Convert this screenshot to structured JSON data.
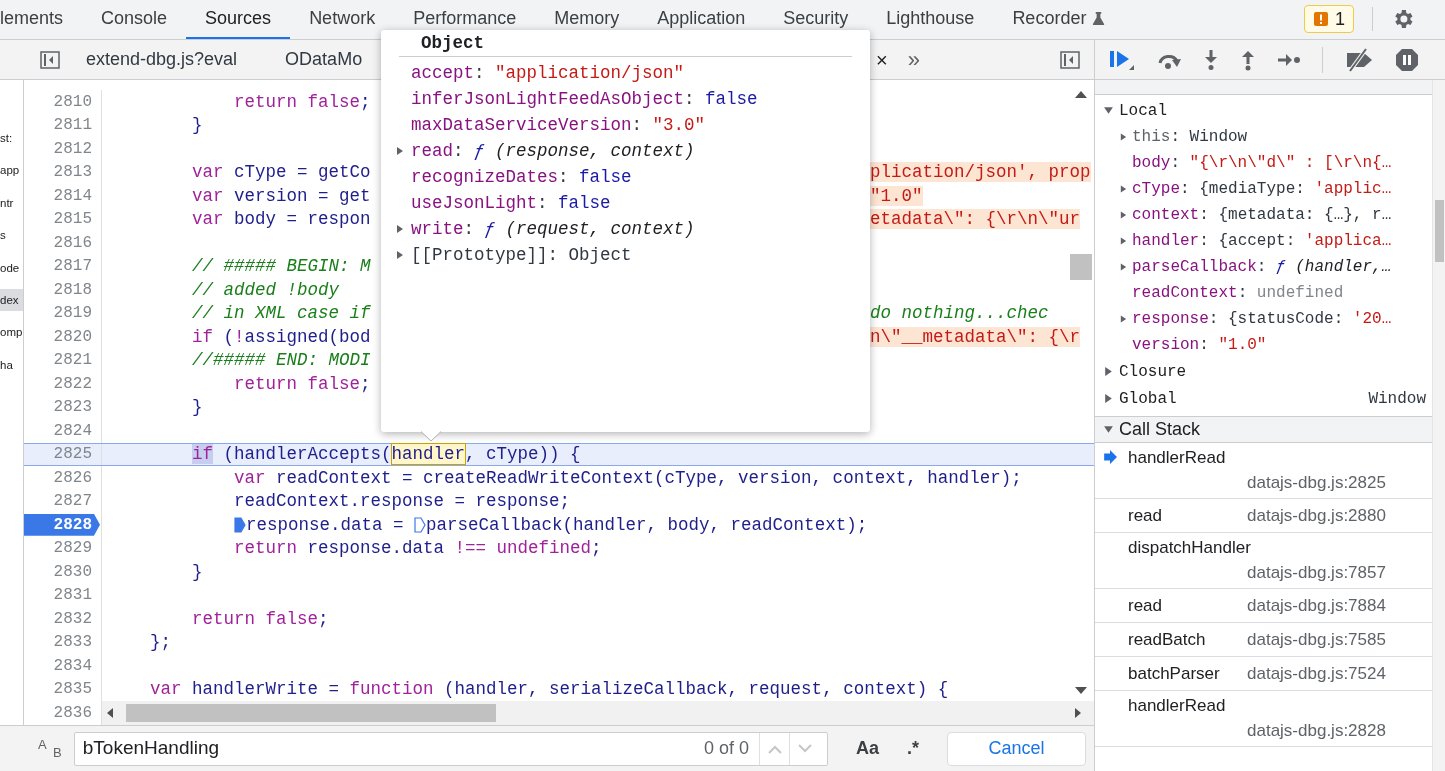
{
  "tabs": [
    {
      "label": "lements",
      "selected": false,
      "experimental": false
    },
    {
      "label": "Console",
      "selected": false,
      "experimental": false
    },
    {
      "label": "Sources",
      "selected": true,
      "experimental": false
    },
    {
      "label": "Network",
      "selected": false,
      "experimental": false
    },
    {
      "label": "Performance",
      "selected": false,
      "experimental": false
    },
    {
      "label": "Memory",
      "selected": false,
      "experimental": false
    },
    {
      "label": "Application",
      "selected": false,
      "experimental": false
    },
    {
      "label": "Security",
      "selected": false,
      "experimental": false
    },
    {
      "label": "Lighthouse",
      "selected": false,
      "experimental": false
    },
    {
      "label": "Recorder",
      "selected": false,
      "experimental": true
    }
  ],
  "issues": {
    "count": "1"
  },
  "file_tabs": [
    {
      "label": "extend-dbg.js?eval"
    },
    {
      "label": "ODataMo"
    }
  ],
  "file_tabs_close": "×",
  "file_tabs_more": "»",
  "navigator": [
    {
      "text": "st:",
      "selected": false
    },
    {
      "text": "app",
      "selected": false
    },
    {
      "text": "ntr",
      "selected": false
    },
    {
      "text": "s",
      "selected": false
    },
    {
      "text": "ode",
      "selected": false
    },
    {
      "text": "dex",
      "selected": true
    },
    {
      "text": "omp",
      "selected": false
    },
    {
      "text": "ha",
      "selected": false
    }
  ],
  "code_lines": [
    {
      "n": "2810",
      "highlighted": false,
      "breakpoint": false,
      "segs": [
        {
          "kind": "kw",
          "text": "            return false"
        },
        {
          "kind": "id",
          "text": ";"
        }
      ]
    },
    {
      "n": "2811",
      "highlighted": false,
      "breakpoint": false,
      "segs": [
        {
          "kind": "id",
          "text": "        }"
        }
      ]
    },
    {
      "n": "2812",
      "highlighted": false,
      "breakpoint": false
    },
    {
      "n": "2813",
      "highlighted": false,
      "breakpoint": false,
      "segs": [
        {
          "kind": "kw",
          "text": "        var"
        },
        {
          "kind": "id",
          "text": " cType = getCo"
        }
      ],
      "right": [
        {
          "kind": "inline",
          "text": "plication/json', prop"
        }
      ]
    },
    {
      "n": "2814",
      "highlighted": false,
      "breakpoint": false,
      "segs": [
        {
          "kind": "kw",
          "text": "        var"
        },
        {
          "kind": "id",
          "text": " version = get"
        }
      ],
      "right": [
        {
          "kind": "inline",
          "text": "\"1.0\""
        }
      ]
    },
    {
      "n": "2815",
      "highlighted": false,
      "breakpoint": false,
      "segs": [
        {
          "kind": "kw",
          "text": "        var"
        },
        {
          "kind": "id",
          "text": " body = respon"
        }
      ],
      "right": [
        {
          "kind": "inline",
          "text": "etadata\\\": {\\r\\n\\\"ur"
        }
      ]
    },
    {
      "n": "2816",
      "highlighted": false,
      "breakpoint": false
    },
    {
      "n": "2817",
      "highlighted": false,
      "breakpoint": false,
      "segs": [
        {
          "kind": "comment",
          "text": "        // ##### BEGIN: M"
        }
      ]
    },
    {
      "n": "2818",
      "highlighted": false,
      "breakpoint": false,
      "segs": [
        {
          "kind": "comment",
          "text": "        // added !body"
        }
      ]
    },
    {
      "n": "2819",
      "highlighted": false,
      "breakpoint": false,
      "segs": [
        {
          "kind": "comment",
          "text": "        // in XML case if"
        }
      ],
      "right": [
        {
          "kind": "comment",
          "text": "do nothing...chec"
        }
      ]
    },
    {
      "n": "2820",
      "highlighted": false,
      "breakpoint": false,
      "segs": [
        {
          "kind": "kw",
          "text": "        if"
        },
        {
          "kind": "id",
          "text": " ("
        },
        {
          "kind": "kw",
          "text": "!"
        },
        {
          "kind": "id",
          "text": "assigned(bod"
        }
      ],
      "right": [
        {
          "kind": "inline",
          "text": "n\\\"__metadata\\\": {\\r"
        }
      ]
    },
    {
      "n": "2821",
      "highlighted": false,
      "breakpoint": false,
      "segs": [
        {
          "kind": "comment",
          "text": "        //##### END: MODI"
        }
      ]
    },
    {
      "n": "2822",
      "highlighted": false,
      "breakpoint": false,
      "segs": [
        {
          "kind": "kw",
          "text": "            return false"
        },
        {
          "kind": "id",
          "text": ";"
        }
      ]
    },
    {
      "n": "2823",
      "highlighted": false,
      "breakpoint": false,
      "segs": [
        {
          "kind": "id",
          "text": "        }"
        }
      ]
    },
    {
      "n": "2824",
      "highlighted": false,
      "breakpoint": false
    },
    {
      "n": "2825",
      "highlighted": true,
      "breakpoint": false,
      "segs": [
        {
          "kind": "kwsel",
          "text": "        if"
        },
        {
          "kind": "id",
          "text": " (handlerAccepts("
        },
        {
          "kind": "hover",
          "text": "handler"
        },
        {
          "kind": "id",
          "text": ", cType)) {"
        }
      ]
    },
    {
      "n": "2826",
      "highlighted": false,
      "breakpoint": false,
      "segs": [
        {
          "kind": "kw",
          "text": "            var"
        },
        {
          "kind": "id",
          "text": " readContext = createReadWriteContext(cType, version, context, handler);"
        }
      ]
    },
    {
      "n": "2827",
      "highlighted": false,
      "breakpoint": false,
      "segs": [
        {
          "kind": "id",
          "text": "            readContext.response = response;"
        }
      ]
    },
    {
      "n": "2828",
      "highlighted": false,
      "breakpoint": true,
      "segs": [
        {
          "kind": "id",
          "text": "            response.data = ",
          "marker_filled": true
        },
        {
          "kind": "id",
          "text": "parseCallback(handler, body, readContext);",
          "marker_filled": false
        }
      ]
    },
    {
      "n": "2829",
      "highlighted": false,
      "breakpoint": false,
      "segs": [
        {
          "kind": "kw",
          "text": "            return"
        },
        {
          "kind": "id",
          "text": " response.data "
        },
        {
          "kind": "kw",
          "text": "!== undefined"
        },
        {
          "kind": "id",
          "text": ";"
        }
      ]
    },
    {
      "n": "2830",
      "highlighted": false,
      "breakpoint": false,
      "segs": [
        {
          "kind": "id",
          "text": "        }"
        }
      ]
    },
    {
      "n": "2831",
      "highlighted": false,
      "breakpoint": false
    },
    {
      "n": "2832",
      "highlighted": false,
      "breakpoint": false,
      "segs": [
        {
          "kind": "kw",
          "text": "        return false"
        },
        {
          "kind": "id",
          "text": ";"
        }
      ]
    },
    {
      "n": "2833",
      "highlighted": false,
      "breakpoint": false,
      "segs": [
        {
          "kind": "id",
          "text": "    };"
        }
      ]
    },
    {
      "n": "2834",
      "highlighted": false,
      "breakpoint": false
    },
    {
      "n": "2835",
      "highlighted": false,
      "breakpoint": false,
      "segs": [
        {
          "kind": "kw",
          "text": "    var"
        },
        {
          "kind": "id",
          "text": " handlerWrite = "
        },
        {
          "kind": "kw",
          "text": "function"
        },
        {
          "kind": "id",
          "text": " (handler, serializeCallback, request, context) {"
        }
      ]
    },
    {
      "n": "2836",
      "highlighted": false,
      "breakpoint": false
    }
  ],
  "popover": {
    "title": "Object",
    "props": [
      {
        "name": "accept",
        "dim": false,
        "expandable": false,
        "value": [
          {
            "kind": "sep",
            "text": ": "
          },
          {
            "kind": "str",
            "text": "\"application/json\""
          }
        ]
      },
      {
        "name": "inferJsonLightFeedAsObject",
        "dim": false,
        "expandable": false,
        "value": [
          {
            "kind": "sep",
            "text": ": "
          },
          {
            "kind": "bool",
            "text": "false"
          }
        ]
      },
      {
        "name": "maxDataServiceVersion",
        "dim": false,
        "expandable": false,
        "value": [
          {
            "kind": "sep",
            "text": ": "
          },
          {
            "kind": "str",
            "text": "\"3.0\""
          }
        ]
      },
      {
        "name": "read",
        "dim": false,
        "expandable": true,
        "value": [
          {
            "kind": "sep",
            "text": ": "
          },
          {
            "kind": "fn",
            "text": "ƒ"
          },
          {
            "kind": "italic",
            "text": " (response, context)"
          }
        ]
      },
      {
        "name": "recognizeDates",
        "dim": false,
        "expandable": false,
        "value": [
          {
            "kind": "sep",
            "text": ": "
          },
          {
            "kind": "bool",
            "text": "false"
          }
        ]
      },
      {
        "name": "useJsonLight",
        "dim": false,
        "expandable": false,
        "value": [
          {
            "kind": "sep",
            "text": ": "
          },
          {
            "kind": "bool",
            "text": "false"
          }
        ]
      },
      {
        "name": "write",
        "dim": false,
        "expandable": true,
        "value": [
          {
            "kind": "sep",
            "text": ": "
          },
          {
            "kind": "fn",
            "text": "ƒ"
          },
          {
            "kind": "italic",
            "text": " (request, context)"
          }
        ]
      },
      {
        "name": "[[Prototype]]",
        "dim": true,
        "expandable": true,
        "value": [
          {
            "kind": "sep",
            "text": ": "
          },
          {
            "kind": "plain",
            "text": "Object"
          }
        ]
      }
    ]
  },
  "scope": [
    {
      "name": "Local",
      "expanded": true,
      "children": [
        {
          "name": "this",
          "dim": true,
          "expandable": true,
          "value": [
            {
              "kind": "sep",
              "text": ": "
            },
            {
              "kind": "plain",
              "text": "Window"
            }
          ]
        },
        {
          "name": "body",
          "dim": false,
          "expandable": false,
          "value": [
            {
              "kind": "sep",
              "text": ": "
            },
            {
              "kind": "str",
              "text": "\"{\\r\\n\\\"d\\\" : [\\r\\n{…"
            }
          ]
        },
        {
          "name": "cType",
          "dim": false,
          "expandable": true,
          "value": [
            {
              "kind": "sep",
              "text": ": "
            },
            {
              "kind": "plain",
              "text": "{mediaType: "
            },
            {
              "kind": "str",
              "text": "'applic…"
            }
          ]
        },
        {
          "name": "context",
          "dim": false,
          "expandable": true,
          "value": [
            {
              "kind": "sep",
              "text": ": "
            },
            {
              "kind": "plain",
              "text": "{metadata: {…}, r…"
            }
          ]
        },
        {
          "name": "handler",
          "dim": false,
          "expandable": true,
          "value": [
            {
              "kind": "sep",
              "text": ": "
            },
            {
              "kind": "plain",
              "text": "{accept: "
            },
            {
              "kind": "str",
              "text": "'applica…"
            }
          ]
        },
        {
          "name": "parseCallback",
          "dim": false,
          "expandable": true,
          "value": [
            {
              "kind": "sep",
              "text": ": "
            },
            {
              "kind": "fn",
              "text": "ƒ"
            },
            {
              "kind": "italic",
              "text": " (handler,…"
            }
          ]
        },
        {
          "name": "readContext",
          "dim": false,
          "expandable": false,
          "value": [
            {
              "kind": "sep",
              "text": ": "
            },
            {
              "kind": "undef",
              "text": "undefined"
            }
          ]
        },
        {
          "name": "response",
          "dim": false,
          "expandable": true,
          "value": [
            {
              "kind": "sep",
              "text": ": "
            },
            {
              "kind": "plain",
              "text": "{statusCode: "
            },
            {
              "kind": "str",
              "text": "'20…"
            }
          ]
        },
        {
          "name": "version",
          "dim": false,
          "expandable": false,
          "value": [
            {
              "kind": "sep",
              "text": ": "
            },
            {
              "kind": "str",
              "text": "\"1.0\""
            }
          ]
        }
      ]
    },
    {
      "name": "Closure",
      "expanded": false
    },
    {
      "name": "Global",
      "expanded": false,
      "value": "Window"
    }
  ],
  "call_stack": {
    "title": "Call Stack",
    "expanded": true,
    "frames": [
      {
        "name": "handlerRead",
        "location": "datajs-dbg.js:2825",
        "current": true,
        "stacked": true
      },
      {
        "name": "read",
        "location": "datajs-dbg.js:2880",
        "current": false,
        "stacked": false
      },
      {
        "name": "dispatchHandler",
        "location": "datajs-dbg.js:7857",
        "current": false,
        "stacked": true
      },
      {
        "name": "read",
        "location": "datajs-dbg.js:7884",
        "current": false,
        "stacked": false
      },
      {
        "name": "readBatch",
        "location": "datajs-dbg.js:7585",
        "current": false,
        "stacked": false
      },
      {
        "name": "batchParser",
        "location": "datajs-dbg.js:7524",
        "current": false,
        "stacked": false
      },
      {
        "name": "handlerRead",
        "location": "datajs-dbg.js:2828",
        "current": false,
        "stacked": true
      }
    ]
  },
  "search": {
    "toggle": [
      "A",
      "B"
    ],
    "value": "bTokenHandling",
    "count": "0 of 0",
    "prev_disabled": true,
    "next_disabled": true,
    "case_label": "Aa",
    "regex_label": ".*",
    "cancel": "Cancel"
  }
}
